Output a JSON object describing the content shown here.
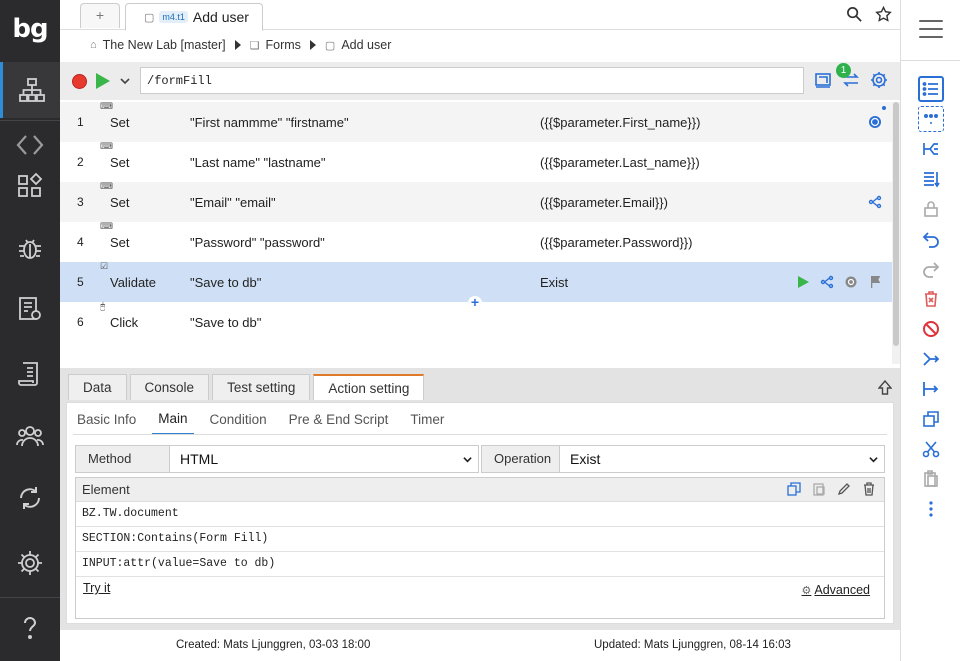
{
  "app": {
    "logo_text": "bg"
  },
  "tabs": {
    "new_tab_label": "+",
    "active_badge": "m4.t1",
    "active_title": "Add user"
  },
  "breadcrumb": {
    "project": "The New Lab [master]",
    "folder": "Forms",
    "page": "Add user"
  },
  "command": {
    "value": "/formFill",
    "sync_badge": "1"
  },
  "steps": [
    {
      "num": "1",
      "action": "Set",
      "target": "\"First nammme\" \"firstname\"",
      "value": "({{$parameter.First_name}})"
    },
    {
      "num": "2",
      "action": "Set",
      "target": "\"Last name\" \"lastname\"",
      "value": "({{$parameter.Last_name}})"
    },
    {
      "num": "3",
      "action": "Set",
      "target": "\"Email\" \"email\"",
      "value": "({{$parameter.Email}})"
    },
    {
      "num": "4",
      "action": "Set",
      "target": "\"Password\" \"password\"",
      "value": "({{$parameter.Password}})"
    },
    {
      "num": "5",
      "action": "Validate",
      "target": "\"Save to db\"",
      "value": "Exist"
    },
    {
      "num": "6",
      "action": "Click",
      "target": "\"Save to db\"",
      "value": ""
    }
  ],
  "bottom_tabs": [
    "Data",
    "Console",
    "Test setting",
    "Action setting"
  ],
  "sub_tabs": [
    "Basic Info",
    "Main",
    "Condition",
    "Pre & End Script",
    "Timer"
  ],
  "form": {
    "method_label": "Method",
    "method_value": "HTML",
    "operation_label": "Operation",
    "operation_value": "Exist",
    "element_label": "Element",
    "element_lines": [
      "BZ.TW.document",
      "SECTION:Contains(Form Fill)",
      "INPUT:attr(value=Save to db)"
    ],
    "try_it": "Try it",
    "advanced": "Advanced"
  },
  "footer": {
    "created": "Created: Mats Ljunggren, 03-03 18:00",
    "updated": "Updated: Mats Ljunggren, 08-14 16:03"
  },
  "colors": {
    "accent": "#2a6fd6",
    "selected_row": "#cfe0f6",
    "active_tab_border": "#e07a2b",
    "sidebar": "#2b2b2d"
  }
}
